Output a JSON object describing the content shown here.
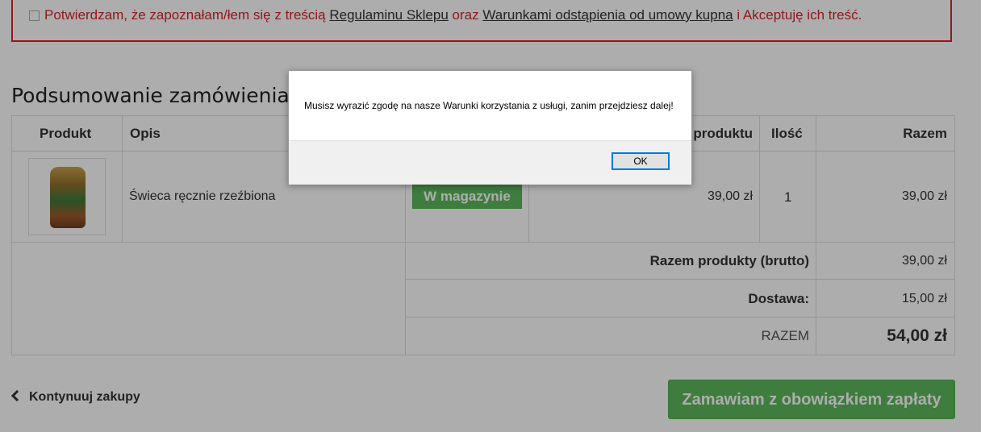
{
  "terms": {
    "prefix": "Potwierdzam, że zapoznałam/łem się z treścią",
    "link_regulamin": "Regulaminu Sklepu",
    "middle": "oraz",
    "link_warunki": "Warunkami odstąpienia od umowy kupna",
    "suffix": "i Akceptuję ich treść."
  },
  "summary": {
    "title": "Podsumowanie zamówienia"
  },
  "table": {
    "headers": {
      "product": "Produkt",
      "description": "Opis",
      "unit_price": "produktu",
      "qty": "Ilość",
      "total": "Razem"
    },
    "row": {
      "name": "Świeca ręcznie rzeźbiona",
      "availability": "W magazynie",
      "unit_price": "39,00 zł",
      "qty": "1",
      "total": "39,00 zł"
    },
    "totals": {
      "products_label": "Razem produkty (brutto)",
      "products_value": "39,00 zł",
      "shipping_label": "Dostawa:",
      "shipping_value": "15,00 zł",
      "grand_label": "RAZEM",
      "grand_value": "54,00 zł"
    }
  },
  "actions": {
    "continue_label": "Kontynuuj zakupy",
    "order_label": "Zamawiam z obowiązkiem zapłaty"
  },
  "dialog": {
    "message": "Musisz wyrazić zgodę na nasze Warunki korzystania z usługi, zanim przejdziesz dalej!",
    "ok_label": "OK"
  },
  "colors": {
    "error_red": "#d9232d",
    "success_green": "#5cb85c",
    "dialog_focus": "#0078d7"
  }
}
